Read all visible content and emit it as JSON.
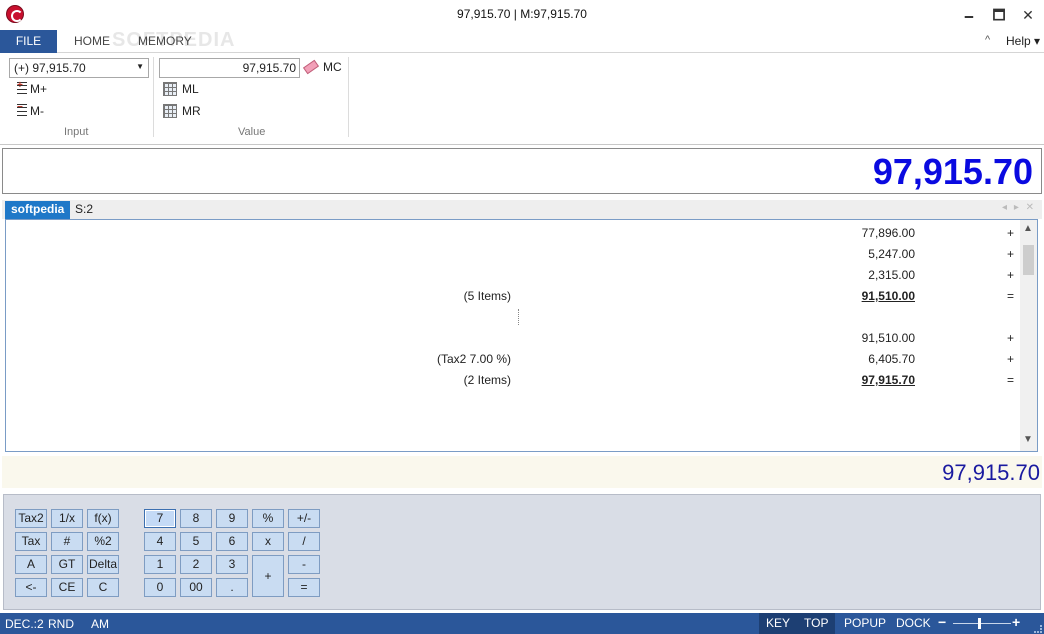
{
  "window": {
    "title": "97,915.70 | M:97,915.70",
    "minimize": "🗕",
    "maximize": "🗖",
    "close": "✕"
  },
  "ribbon": {
    "tabs": {
      "file": "FILE",
      "home": "HOME",
      "memory": "MEMORY"
    },
    "watermark": "SOFTPEDIA",
    "help": "Help ▾",
    "collapse": "^",
    "input_group": {
      "select_value": "(+) 97,915.70",
      "m_plus": "M+",
      "m_minus": "M-",
      "label": "Input"
    },
    "value_group": {
      "field_value": "97,915.70",
      "mc": "MC",
      "ml": "ML",
      "mr": "MR",
      "label": "Value"
    }
  },
  "display": {
    "value": "97,915.70"
  },
  "tape_tabs": {
    "active": "softpedia",
    "second": "S:2",
    "controls": "◂ ▸ ✕"
  },
  "tape": {
    "rows": [
      {
        "label": "",
        "value": "77,896.00",
        "op": "+",
        "total": false
      },
      {
        "label": "",
        "value": "5,247.00",
        "op": "+",
        "total": false
      },
      {
        "label": "",
        "value": "2,315.00",
        "op": "+",
        "total": false
      },
      {
        "label": "(5 Items)",
        "value": "91,510.00",
        "op": "=",
        "total": true
      },
      {
        "label": "",
        "value": "",
        "op": "",
        "total": false
      },
      {
        "label": "",
        "value": "91,510.00",
        "op": "+",
        "total": false
      },
      {
        "label": "(Tax2 7.00 %)",
        "value": "6,405.70",
        "op": "+",
        "total": false
      },
      {
        "label": "(2 Items)",
        "value": "97,915.70",
        "op": "=",
        "total": true
      }
    ],
    "scroll_up": "▲",
    "scroll_down": "▼"
  },
  "result": {
    "value": "97,915.70"
  },
  "keypad": {
    "tax2": "Tax2",
    "reciprocal": "1/x",
    "fx": "f(x)",
    "tax": "Tax",
    "hash": "#",
    "pct2": "%2",
    "a": "A",
    "gt": "GT",
    "delta": "Delta",
    "back": "<-",
    "ce": "CE",
    "c": "C",
    "k7": "7",
    "k8": "8",
    "k9": "9",
    "percent": "%",
    "plusminus": "+/-",
    "k4": "4",
    "k5": "5",
    "k6": "6",
    "multiply": "x",
    "divide": "/",
    "k1": "1",
    "k2": "2",
    "k3": "3",
    "plus": "+",
    "minus": "-",
    "k0": "0",
    "k00": "00",
    "decimal": ".",
    "equals": "="
  },
  "statusbar": {
    "dec": "DEC.:2",
    "rnd": "RND",
    "am": "AM",
    "key": "KEY",
    "top": "TOP",
    "popup": "POPUP",
    "dock": "DOCK",
    "zoom_minus": "−",
    "zoom_plus": "+"
  }
}
